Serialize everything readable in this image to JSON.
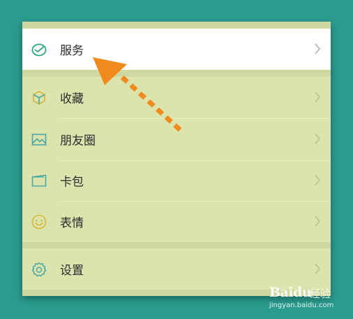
{
  "menu": {
    "service": {
      "label": "服务",
      "icon": "wallet-check-icon"
    },
    "favorites": {
      "label": "收藏",
      "icon": "cube-icon"
    },
    "moments": {
      "label": "朋友圈",
      "icon": "image-icon"
    },
    "cards": {
      "label": "卡包",
      "icon": "card-wallet-icon"
    },
    "stickers": {
      "label": "表情",
      "icon": "smiley-icon"
    },
    "settings": {
      "label": "设置",
      "icon": "gear-icon"
    }
  },
  "colors": {
    "background": "#2a9c8e",
    "panel": "#dce4ae",
    "highlight_row": "#ffffff",
    "arrow": "#f08a1c",
    "icon_green": "#2aa882",
    "icon_teal": "#4aa6a0",
    "icon_gold": "#d9b43b"
  },
  "watermark": {
    "logo": "Baidu",
    "text": "经验",
    "url": "jingyan.baidu.com"
  }
}
